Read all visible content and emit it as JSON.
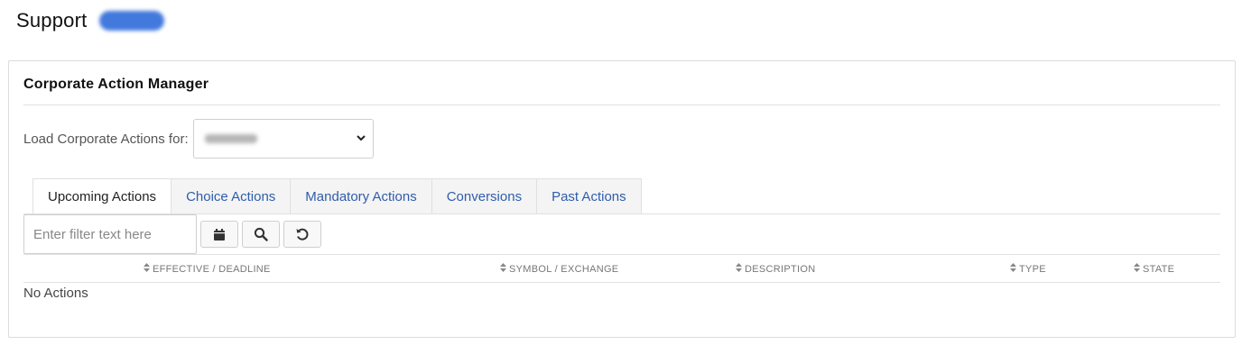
{
  "header": {
    "title": "Support",
    "account_badge": "",
    "badge_color": "#2e6bd9"
  },
  "panel": {
    "title": "Corporate Action Manager",
    "load_label": "Load Corporate Actions for:",
    "account_select_value": "",
    "tabs": [
      {
        "label": "Upcoming Actions",
        "active": true
      },
      {
        "label": "Choice Actions",
        "active": false
      },
      {
        "label": "Mandatory Actions",
        "active": false
      },
      {
        "label": "Conversions",
        "active": false
      },
      {
        "label": "Past Actions",
        "active": false
      }
    ],
    "filter": {
      "value": "",
      "placeholder": "Enter filter text here"
    },
    "toolbar_icons": [
      "calendar-icon",
      "search-icon",
      "reset-icon"
    ],
    "table": {
      "columns": [
        "EFFECTIVE / DEADLINE",
        "SYMBOL / EXCHANGE",
        "DESCRIPTION",
        "TYPE",
        "STATE"
      ],
      "empty_message": "No Actions"
    }
  },
  "colors": {
    "link": "#2f5dab",
    "border": "#dcdcdc",
    "tab_inactive_bg": "#f4f4f4"
  }
}
